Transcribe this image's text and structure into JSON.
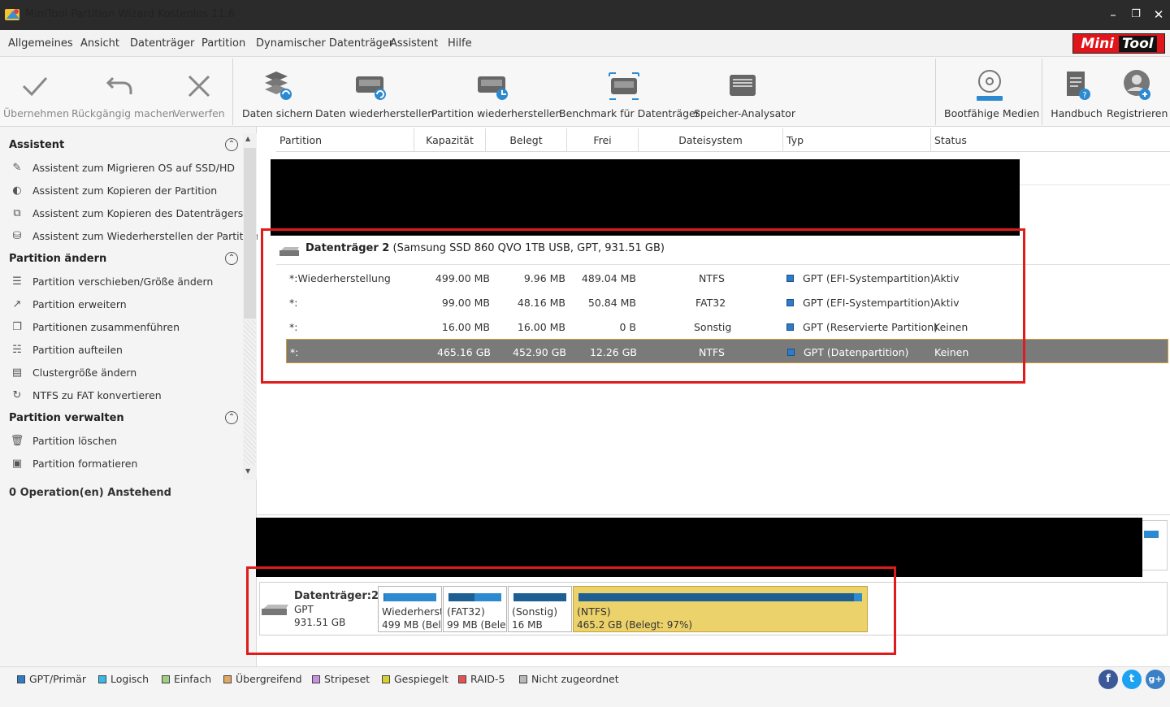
{
  "window": {
    "title": "MiniTool Partition Wizard Kostenlos 11.6"
  },
  "menu": {
    "items": [
      "Allgemeines",
      "Ansicht",
      "Datenträger",
      "Partition",
      "Dynamischer Datenträger",
      "Assistent",
      "Hilfe"
    ]
  },
  "logo": {
    "mini": "Mini",
    "tool": "Tool"
  },
  "toolbar": {
    "apply": "Übernehmen",
    "undo": "Rückgängig machen",
    "discard": "Verwerfen",
    "backup": "Daten sichern",
    "recover": "Daten wiederherstellen",
    "partrecover": "Partition wiederherstellen",
    "benchmark": "Benchmark für Datenträger",
    "analyzer": "Speicher-Analysator",
    "bootmedia": "Bootfähige Medien",
    "manual": "Handbuch",
    "register": "Registrieren"
  },
  "sidebar": {
    "sections": [
      {
        "title": "Assistent",
        "items": [
          "Assistent zum Migrieren OS auf SSD/HD",
          "Assistent zum Kopieren der Partition",
          "Assistent zum Kopieren des Datenträgers",
          "Assistent zum Wiederherstellen der Partition"
        ]
      },
      {
        "title": "Partition ändern",
        "items": [
          "Partition verschieben/Größe ändern",
          "Partition erweitern",
          "Partitionen zusammenführen",
          "Partition aufteilen",
          "Clustergröße ändern",
          "NTFS zu FAT konvertieren"
        ]
      },
      {
        "title": "Partition verwalten",
        "items": [
          "Partition löschen",
          "Partition formatieren"
        ]
      }
    ],
    "pending": "0 Operation(en) Anstehend"
  },
  "table": {
    "columns": [
      "Partition",
      "Kapazität",
      "Belegt",
      "Frei",
      "Dateisystem",
      "Typ",
      "Status"
    ],
    "disk_name": "Datenträger 2",
    "disk_detail": "(Samsung SSD 860 QVO 1TB USB, GPT, 931.51 GB)",
    "rows": [
      {
        "partition": "*:Wiederherstellung",
        "capacity": "499.00 MB",
        "used": "9.96 MB",
        "free": "489.04 MB",
        "fs": "NTFS",
        "type": "GPT (EFI-Systempartition)",
        "status": "Aktiv"
      },
      {
        "partition": "*:",
        "capacity": "99.00 MB",
        "used": "48.16 MB",
        "free": "50.84 MB",
        "fs": "FAT32",
        "type": "GPT (EFI-Systempartition)",
        "status": "Aktiv"
      },
      {
        "partition": "*:",
        "capacity": "16.00 MB",
        "used": "16.00 MB",
        "free": "0 B",
        "fs": "Sonstig",
        "type": "GPT (Reservierte Partition)",
        "status": "Keinen"
      },
      {
        "partition": "*:",
        "capacity": "465.16 GB",
        "used": "452.90 GB",
        "free": "12.26 GB",
        "fs": "NTFS",
        "type": "GPT (Datenpartition)",
        "status": "Keinen",
        "selected": true
      }
    ]
  },
  "diskmap": {
    "disk": {
      "name": "Datenträger:2",
      "scheme": "GPT",
      "size": "931.51 GB"
    },
    "partitions": [
      {
        "label": "Wiederherst",
        "size": "499 MB (Bel",
        "used_fraction": 0.02
      },
      {
        "label": "(FAT32)",
        "size": "99 MB (Bele",
        "used_fraction": 0.49
      },
      {
        "label": "(Sonstig)",
        "size": "16 MB",
        "used_fraction": 1.0
      },
      {
        "label": "(NTFS)",
        "size": "465.2 GB (Belegt: 97%)",
        "used_fraction": 0.97,
        "selected": true
      }
    ]
  },
  "legend": [
    {
      "label": "GPT/Primär",
      "color": "#2e7bc8"
    },
    {
      "label": "Logisch",
      "color": "#38b8e8"
    },
    {
      "label": "Einfach",
      "color": "#9ed080"
    },
    {
      "label": "Übergreifend",
      "color": "#e0a860"
    },
    {
      "label": "Stripeset",
      "color": "#c890e0"
    },
    {
      "label": "Gespiegelt",
      "color": "#d8d030"
    },
    {
      "label": "RAID-5",
      "color": "#e85050"
    },
    {
      "label": "Nicht zugeordnet",
      "color": "#b8b8b8"
    }
  ],
  "social": {
    "facebook": "f",
    "twitter": "t",
    "google": "g+"
  }
}
